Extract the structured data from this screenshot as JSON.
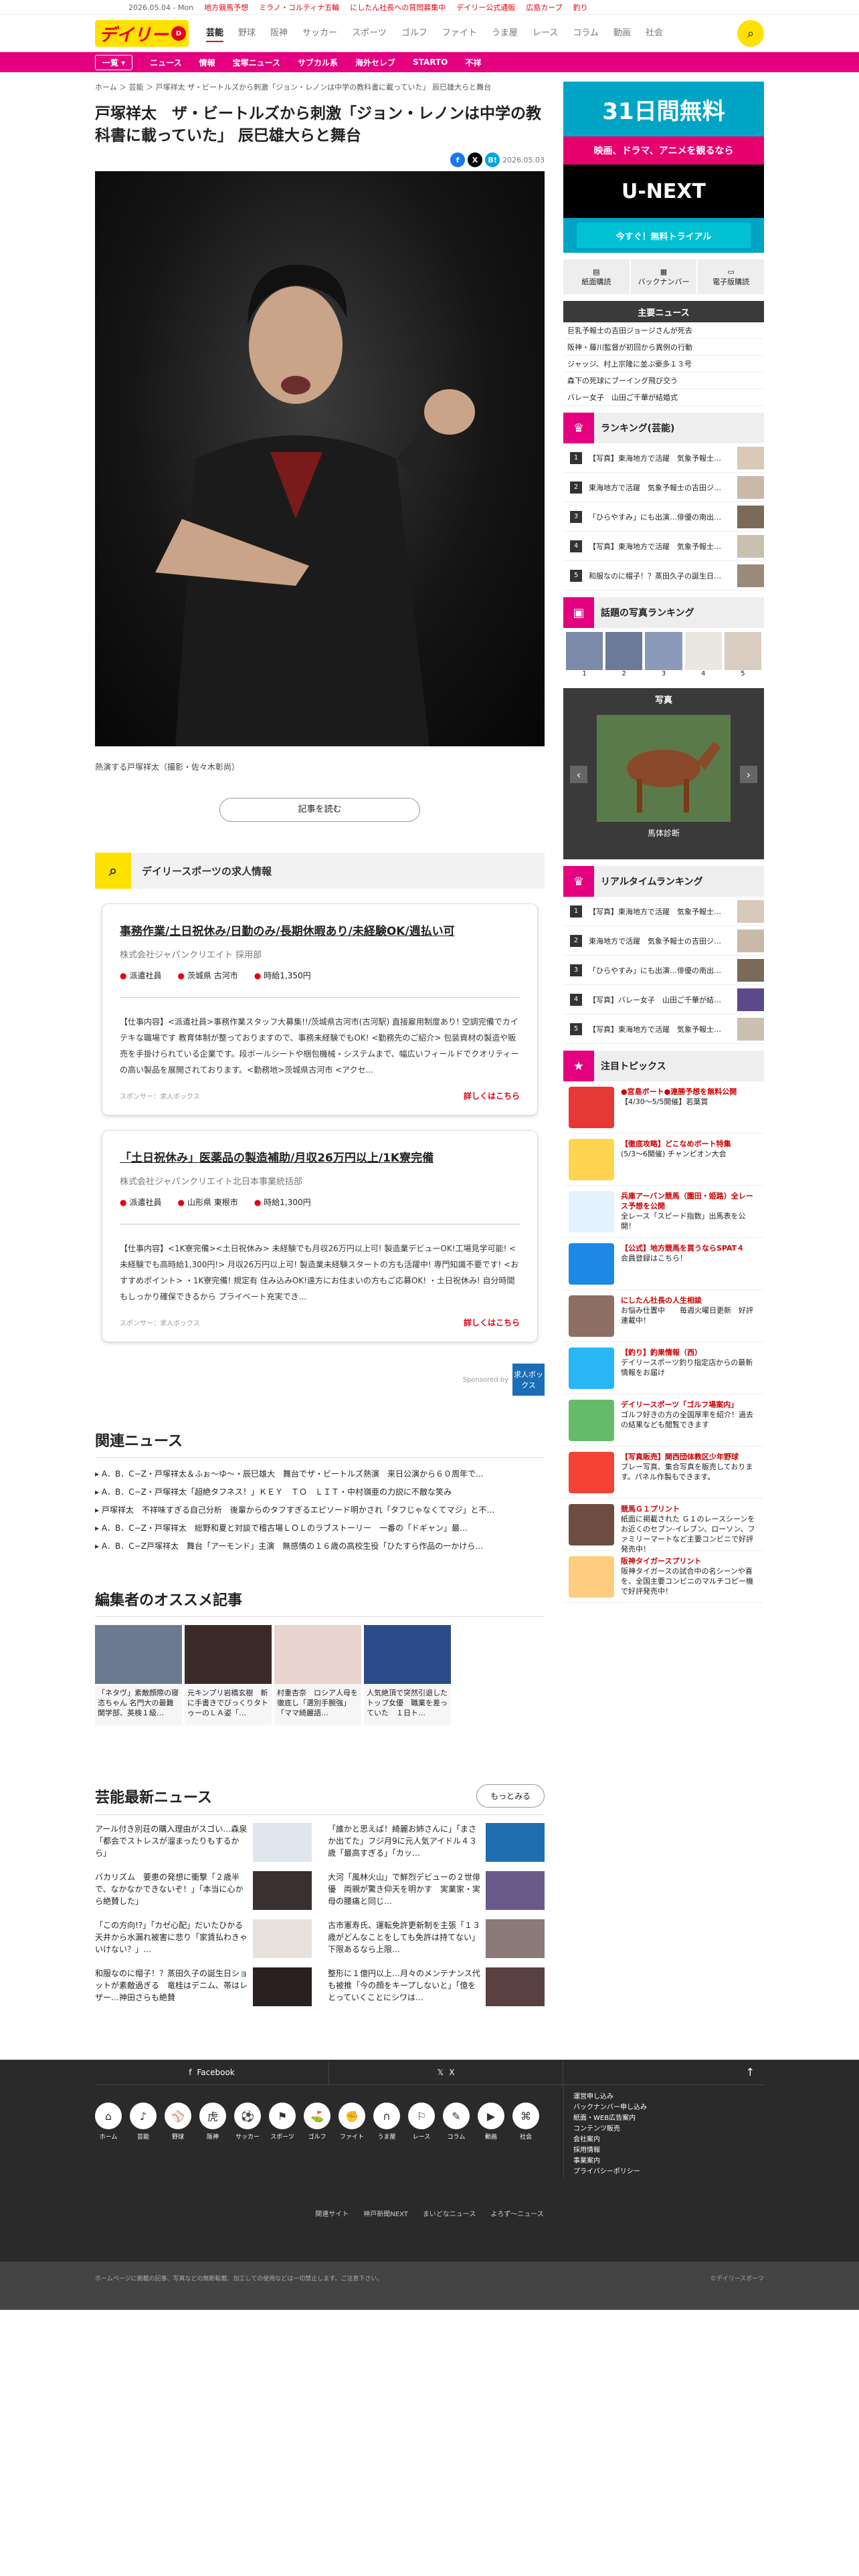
{
  "topbar": {
    "date": "2026.05.04 - Mon",
    "links": [
      "地方競馬予想",
      "ミラノ・コルティナ五輪",
      "にしたん社長への質問募集中",
      "デイリー公式通販",
      "広島カープ",
      "釣り"
    ]
  },
  "header": {
    "logo": "デイリー",
    "logo_badge": "D",
    "nav": [
      "芸能",
      "野球",
      "阪神",
      "サッカー",
      "スポーツ",
      "ゴルフ",
      "ファイト",
      "うま屋",
      "レース",
      "コラム",
      "動画",
      "社会"
    ]
  },
  "subnav": [
    "一覧 ▾",
    "ニュース",
    "情報",
    "宝塚ニュース",
    "サブカル系",
    "海外セレブ",
    "STARTO",
    "不祥"
  ],
  "breadcrumb": "ホーム ＞ 芸能 ＞ 戸塚祥太 ザ・ビートルズから刺激「ジョン・レノンは中学の教科書に載っていた」 辰巳雄大らと舞台",
  "article": {
    "title": "戸塚祥太　ザ・ビートルズから刺激「ジョン・レノンは中学の教科書に載っていた」 辰巳雄大らと舞台",
    "date": "2026.05.03",
    "caption": "熱演する戸塚祥太（撮影・佐々木彰尚）",
    "read_more": "記事を読む"
  },
  "jobs": {
    "header": "デイリースポーツの求人情報",
    "items": [
      {
        "title": "事務作業/土日祝休み/日勤のみ/長期休暇あり/未経験OK/週払い可",
        "company": "株式会社ジャパンクリエイト 採用部",
        "meta": [
          "派遣社員",
          "茨城県 古河市",
          "時給1,350円"
        ],
        "desc": "【仕事内容】<派遣社員>事務作業スタッフ大募集!!/茨城県古河市(古河駅) 直接雇用制度あり! 空調完備でカイテキな職場です 教育体制が整っておりますので、事務未経験でもOK! <勤務先のご紹介> 包装資材の製造や販売を手掛けられている企業です。段ボールシートや梱包機械・システムまで、幅広いフィールドでクオリティーの高い製品を展開されております。<勤務地>茨城県古河市 <アクセ...",
        "sponsor": "スポンサー：求人ボックス",
        "more": "詳しくはこちら"
      },
      {
        "title": "「土日祝休み」医薬品の製造補助/月収26万円以上/1K寮完備",
        "company": "株式会社ジャパンクリエイト北日本事業統括部",
        "meta": [
          "派遣社員",
          "山形県 東根市",
          "時給1,300円"
        ],
        "desc": "【仕事内容】<1K寮完備><土日祝休み> 未経験でも月収26万円以上可! 製造業デビューOK!工場見学可能! <未経験でも高時給1,300円!> 月収26万円以上可! 製造業未経験スタートの方も活躍中! 専門知識不要です! <おすすめポイント> ・1K寮完備! 規定有 住み込みOK!遠方にお住まいの方もご応募OK! ・土日祝休み! 自分時間もしっかり確保できるから プライベート充実でき...",
        "sponsor": "スポンサー：求人ボックス",
        "more": "詳しくはこちら"
      }
    ],
    "sponsored_by": "Sponsored by",
    "sponsor_logo": "求人ボックス"
  },
  "related": {
    "heading": "関連ニュース",
    "items": [
      "A．B．C−Z・戸塚祥太＆ふぉ〜ゆ〜・辰巳雄大　舞台でザ・ビートルズ熱演　来日公演から６０周年で…",
      "A．B．C−Z・戸塚祥太「超絶タフネス！」ＫＥＹ　ＴＯ　ＬＩＴ・中村嶺亜の力説に不敵な笑み",
      "戸塚祥太　不祥味すぎる自己分析　後輩からのタフすぎるエピソード明かされ「タフじゃなくてマジ」と不…",
      "A．B．C−Z・戸塚祥太　総野和夏と対談で稽古場ＬＯＬのラブストーリー　一番の「ドギャン」最…",
      "A．B．C−Z戸塚祥太　舞台「アーモンド」主演　無感情の１６歳の高校生役「ひたすら作品の一かけら…"
    ]
  },
  "osusume": {
    "heading": "編集者のオススメ記事",
    "items": [
      "「ネタヴ」素敵顔際の寝恣ちゃん 名門大の最難関学部、英検１級…",
      "元キンプリ岩橋玄樹　新に手書きでびっくりタトゥーのＬＡ姿「…",
      "村重杏奈　ロシア人母を徹底し「選別手腕強」「ママ綺麗語…",
      "人気絶頂で突然引退したトップ女優　職業を差っていた　１日ト…"
    ]
  },
  "latest": {
    "heading": "芸能最新ニュース",
    "more": "もっとみる",
    "items": [
      "アール付き別荘の購入理由がスゴい…森泉「都会でストレスが溜まったりもするから」",
      "「誰かと思えば！綺麗お姉さんに」「まさか出てた」フジ月9に元人気アイドル４３歳「最高すぎる」「カッ…",
      "バカリズム　要患の発想に衝撃「２歳半で、なかなかできないぞ！」「本当に心から絶賛した」",
      "大河「風林火山」で鮮烈デビューの２世俳優　両親が驚き仰天を明かす　実業家・実母の腰痛と同じ…",
      "「この方向!?」「カゼ心配」だいたひかる　天井から水漏れ被害に悲り「家賃払わきゃいけない？」…",
      "古市憲寿氏、運転免許更新制を主張「１３歳がどんなことをしても免許は持てない」下限あるなら上限…",
      "和服なのに帽子！？蒸田久子の誕生日ショットが素敵過ぎる　竜桂はデニム、帯はレザー…神田さらも絶賛",
      "整形に１億円以上…月々のメンテナンス代も被推「今の顔をキープしないと」「億をとっていくことにシワは…"
    ]
  },
  "footer": {
    "facebook": "Facebook",
    "x": "X",
    "icons": [
      "ホーム",
      "芸能",
      "野球",
      "阪神",
      "サッカー",
      "スポーツ",
      "ゴルフ",
      "ファイト",
      "うま屋",
      "レース",
      "コラム",
      "動画",
      "社会"
    ],
    "menu": [
      "運営申し込み",
      "バックナンバー申し込み",
      "紙面・WEB広告案内",
      "コンテンツ販売",
      "会社案内",
      "採用情報",
      "事業案内",
      "プライバシーポリシー"
    ],
    "sites": [
      "関連サイト",
      "神戸新聞NEXT",
      "まいどなニュース",
      "よろず〜ニュース"
    ],
    "copyright": "ホームページに掲載の記事、写真などの無断転載、加工しての使用などは一切禁止します。ご注意下さい。",
    "corp": "©デイリースポーツ"
  },
  "sidebar": {
    "ad": {
      "line1": "31日間無料",
      "line2": "映画、ドラマ、アニメを観るなら",
      "brand": "U-NEXT",
      "cta": "今すぐ！無料トライアル"
    },
    "tabs": [
      "紙面購読",
      "バックナンバー",
      "電子版購読"
    ],
    "main_news": {
      "heading": "主要ニュース",
      "items": [
        "巨乳予報士の吉田ジョージさんが死去",
        "阪神・藤川監督が初回から異例の行動",
        "ジャッジ、村上宗隆に並ぶ豪多１３号",
        "森下の死球にブーイング飛び交う",
        "バレー女子　山田ご千華が結婚式"
      ]
    },
    "ranking": {
      "heading": "ランキング(芸能)",
      "items": [
        "【写真】東海地方で活躍　気象予報士…",
        "東海地方で活躍　気象予報士の吉田ジ…",
        "「ひらやすみ」にも出演…俳優の南出…",
        "【写真】東海地方で活躍　気象予報士…",
        "和服なのに帽子！？蒸田久子の誕生日…"
      ]
    },
    "photo_ranking": {
      "heading": "話題の写真ランキング",
      "ranks": [
        "1",
        "2",
        "3",
        "4",
        "5"
      ]
    },
    "photo_box": {
      "heading": "写真",
      "caption": "馬体診断"
    },
    "realtime": {
      "heading": "リアルタイムランキング",
      "items": [
        "【写真】東海地方で活躍　気象予報士…",
        "東海地方で活躍　気象予報士の吉田ジ…",
        "「ひらやすみ」にも出演…俳優の南出…",
        "【写真】バレー女子　山田ご千華が結…",
        "【写真】東海地方で活躍　気象予報士…"
      ]
    },
    "topics": {
      "heading": "注目トピックス",
      "items": [
        {
          "t": "●宮島ボート●連勝予想を無料公開",
          "s": "【4/30〜5/5開催】若葉賞"
        },
        {
          "t": "【徹底攻略】どこなめボート特集",
          "s": "(5/3〜6開催) チャンピオン大会"
        },
        {
          "t": "兵庫アーバン競馬（園田・姫路）全レース予想を公開",
          "s": "全レース「スピード指数」出馬表を公開！"
        },
        {
          "t": "【公式】地方競馬を買うならSPAT４",
          "s": "会員登録はこちら！"
        },
        {
          "t": "にしたん社長の人生相談",
          "s": "お悩み仕置中　　毎週火曜日更新　好評連載中！"
        },
        {
          "t": "【釣り】釣果情報（西）",
          "s": "デイリースポーツ釣り指定店からの最新情報をお届け"
        },
        {
          "t": "デイリースポーツ「ゴルフ場案内」",
          "s": "ゴルフ好きの方の全国厚率を紹介！過去の結果なども閲覧できます"
        },
        {
          "t": "【写真販売】関西団体教区少年野球",
          "s": "プレー写真、集合写真を販売しております。パネル作製もできます。"
        },
        {
          "t": "競馬Ｇ１プリント",
          "s": "紙面に掲載された Ｇ１のレースシーンをお近くのセブン-イレブン、ローソン、ファミリーマートなど主要コンビニで好評発売中！"
        },
        {
          "t": "阪神タイガースプリント",
          "s": "阪神タイガースの試合中の名シーンや喜を、全国主要コンビニのマルチコピー機で好評発売中！"
        }
      ]
    }
  },
  "colors": {
    "accent": "#e60012",
    "brand_yellow": "#ffe100",
    "subnav": "#e4007f"
  }
}
